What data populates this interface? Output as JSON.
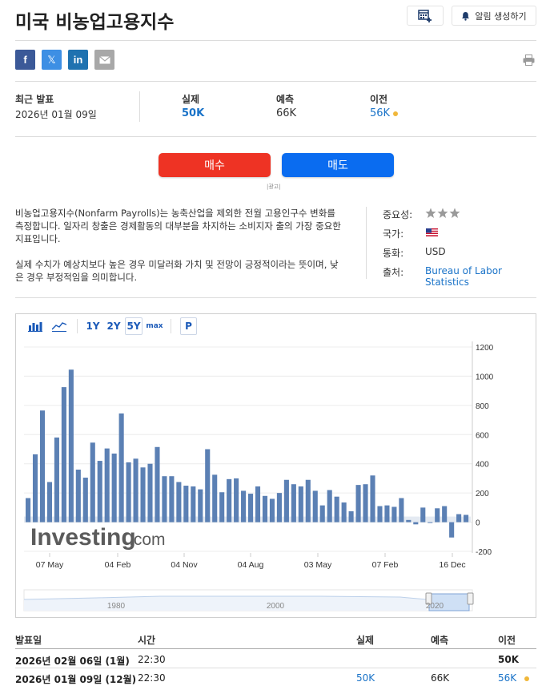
{
  "page_title": "미국 비농업고용지수",
  "header": {
    "alert_label": "알림 생성하기",
    "calendar_icon": "calendar-add-icon",
    "bell_icon": "bell-icon"
  },
  "share": {
    "facebook": "f",
    "x": "𝕏",
    "linkedin": "in"
  },
  "stats": {
    "latest_label": "최근 발표",
    "latest_value": "2026년 01월 09일",
    "actual_label": "실제",
    "actual_value": "50K",
    "forecast_label": "예측",
    "forecast_value": "66K",
    "previous_label": "이전",
    "previous_value": "56K"
  },
  "trade": {
    "buy": "매수",
    "sell": "매도",
    "ad": "|광고|"
  },
  "description": {
    "p1": "비농업고용지수(Nonfarm Payrolls)는 농축산업을 제외한 전월 고용인구수 변화를 측정합니다. 일자리 창출은 경제활동의 대부분을 차지하는 소비지자 출의 가장 중요한 지표입니다.",
    "p2": "실제 수치가 예상치보다 높은 경우 미달러화 가치 및 전망이 긍정적이라는 뜻이며, 낮은 경우 부정적임을 의미합니다."
  },
  "info": {
    "importance_label": "중요성:",
    "country_label": "국가:",
    "currency_label": "통화:",
    "currency_value": "USD",
    "source_label": "출처:",
    "source_value": "Bureau of Labor Statistics"
  },
  "toolbar": {
    "r1y": "1Y",
    "r2y": "2Y",
    "r5y": "5Y",
    "rmax": "max",
    "p": "P"
  },
  "colors": {
    "bar": "#5b80b4",
    "buy": "#ee3324",
    "sell": "#0a6cf0",
    "link": "#1a73c8",
    "dot": "#f0b73a"
  },
  "chart_data": {
    "type": "bar",
    "x_ticks": [
      "07 May",
      "04 Feb",
      "04 Nov",
      "04 Aug",
      "03 May",
      "07 Feb",
      "16 Dec"
    ],
    "y_ticks": [
      "1200",
      "1000",
      "800",
      "600",
      "400",
      "200",
      "0",
      "-200"
    ],
    "ylim": [
      -200,
      1200
    ],
    "values": [
      165,
      465,
      765,
      275,
      580,
      925,
      1045,
      360,
      305,
      545,
      420,
      505,
      470,
      745,
      410,
      435,
      375,
      400,
      515,
      315,
      315,
      275,
      250,
      245,
      225,
      500,
      325,
      205,
      295,
      300,
      215,
      195,
      245,
      180,
      160,
      200,
      290,
      260,
      245,
      290,
      215,
      115,
      220,
      175,
      135,
      75,
      255,
      260,
      320,
      110,
      115,
      105,
      165,
      15,
      -15,
      100,
      -5,
      95,
      110,
      -105,
      55,
      50
    ],
    "brand": "Investing",
    "brand_suffix": ".com",
    "navigator_labels": [
      "1980",
      "2000",
      "2020"
    ]
  },
  "table": {
    "headers": [
      "발표일",
      "시간",
      "실제",
      "예측",
      "이전"
    ],
    "rows": [
      {
        "date": "2026년 02월 06일 (1월)",
        "time": "22:30",
        "actual": "",
        "forecast": "",
        "previous": "50K"
      },
      {
        "date": "2026년 01월 09일 (12월)",
        "time": "22:30",
        "actual": "50K",
        "forecast": "66K",
        "previous": "56K"
      }
    ]
  }
}
